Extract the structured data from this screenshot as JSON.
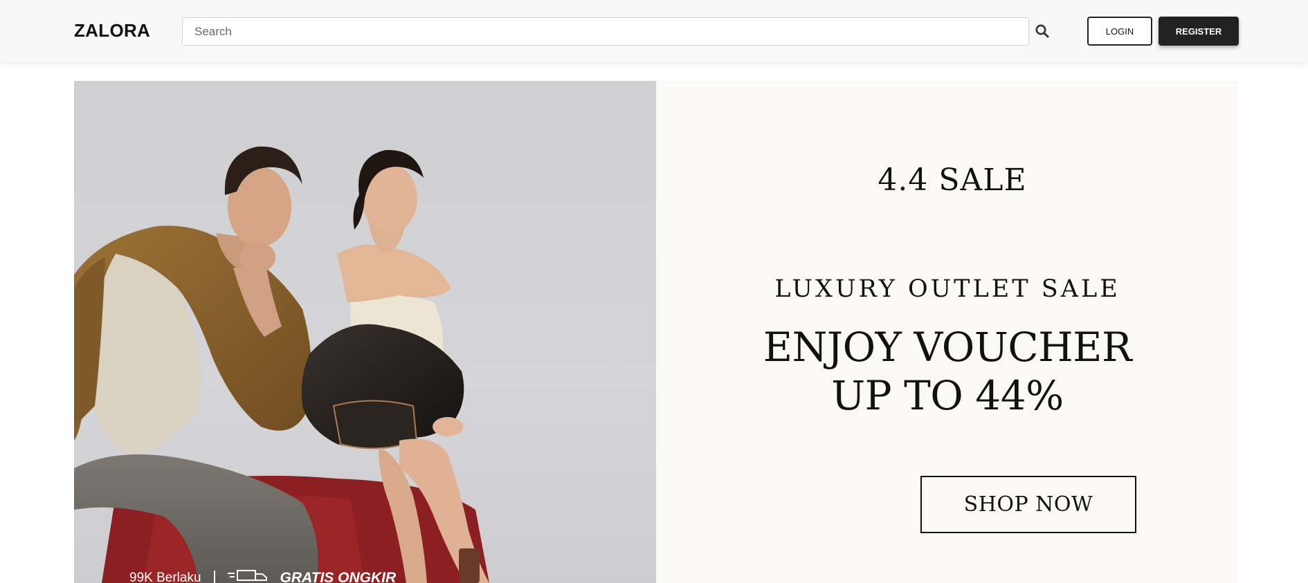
{
  "header": {
    "logo": "ZALORA",
    "search": {
      "placeholder": "Search",
      "value": ""
    },
    "login_label": "LOGIN",
    "register_label": "REGISTER",
    "icons": {
      "search": "search-icon"
    }
  },
  "banner": {
    "sale_title": "4.4 SALE",
    "outlet_title": "LUXURY OUTLET SALE",
    "voucher_line1": "ENJOY VOUCHER",
    "voucher_line2": "UP TO 44%",
    "cta_label": "SHOP NOW",
    "shipping_left": "99K Berlaku",
    "shipping_right": "GRATIS ONGKIR",
    "colors": {
      "photo_bg": "#d0d0d3",
      "promo_bg": "#fbf9f5",
      "jacket": "#8a6430",
      "leather": "#2a2420",
      "seat": "#8c1f22"
    }
  }
}
